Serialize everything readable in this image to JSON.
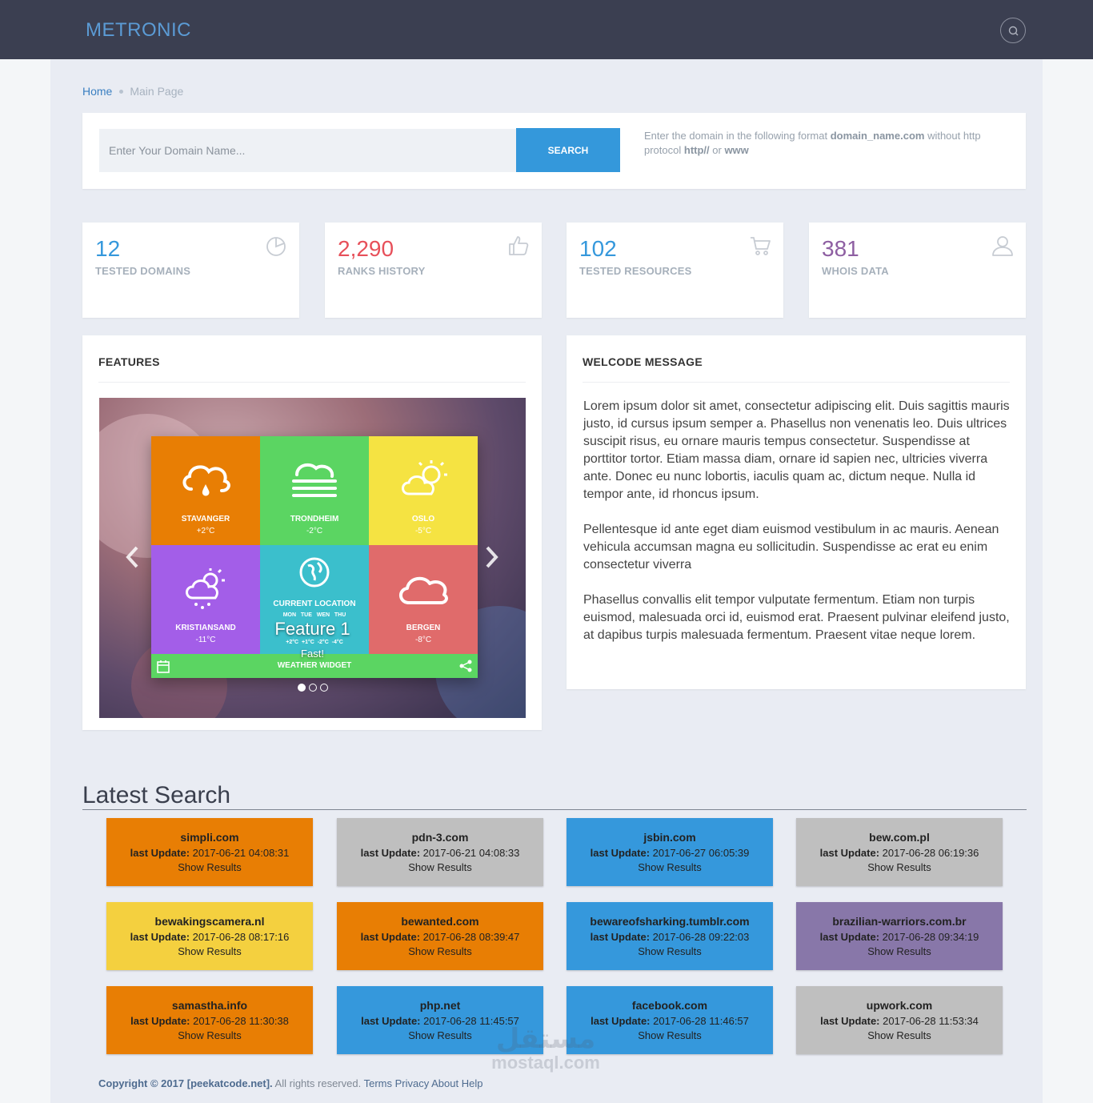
{
  "header": {
    "logo": "METRONIC",
    "search_icon": "search-icon"
  },
  "breadcrumb": {
    "home": "Home",
    "current": "Main Page"
  },
  "search_panel": {
    "placeholder": "Enter Your Domain Name...",
    "button": "SEARCH",
    "help_1": "Enter the domain in the following format ",
    "help_bold_1": "domain_name.com",
    "help_2": " without http protocol ",
    "help_bold_2": "http//",
    "help_3": " or ",
    "help_bold_3": "www"
  },
  "stats": [
    {
      "value": "12",
      "label": "TESTED DOMAINS",
      "color": "#3598dc",
      "icon": "pie-chart-icon"
    },
    {
      "value": "2,290",
      "label": "RANKS HISTORY",
      "color": "#e7505a",
      "icon": "thumbs-up-icon"
    },
    {
      "value": "102",
      "label": "TESTED RESOURCES",
      "color": "#3598dc",
      "icon": "shopping-cart-icon"
    },
    {
      "value": "381",
      "label": "WHOIS DATA",
      "color": "#8e5fa2",
      "icon": "user-icon"
    }
  ],
  "features": {
    "title": "FEATURES",
    "caption": "Feature 1",
    "sub": "Fast!",
    "widget_bar": "WEATHER WIDGET",
    "tiles": [
      {
        "name": "STAVANGER",
        "temp": "+2°C",
        "color": "#e87e04",
        "icon": "rain-cloud-icon"
      },
      {
        "name": "TRONDHEIM",
        "temp": "-2°C",
        "color": "#5bd562",
        "icon": "fog-cloud-icon"
      },
      {
        "name": "OSLO",
        "temp": "-5°C",
        "color": "#f5e342",
        "icon": "sun-cloud-icon"
      },
      {
        "name": "KRISTIANSAND",
        "temp": "-11°C",
        "color": "#a35ee8",
        "icon": "snow-sun-icon"
      },
      {
        "name": "CURRENT LOCATION",
        "temp": "",
        "color": "#3bbfcc",
        "icon": "globe-icon",
        "days": "MON   TUE   WEN   THU",
        "temps": "+2°C  +1°C  -2°C  -4°C"
      },
      {
        "name": "BERGEN",
        "temp": "-8°C",
        "color": "#e06b6b",
        "icon": "cloud-icon"
      }
    ],
    "dots_active": 1
  },
  "welcome": {
    "title": "WELCODE MESSAGE",
    "p1": "Lorem ipsum dolor sit amet, consectetur adipiscing elit. Duis sagittis mauris justo, id cursus ipsum semper a. Phasellus non venenatis leo. Duis ultrices suscipit risus, eu ornare mauris tempus consectetur. Suspendisse at porttitor tortor. Etiam massa diam, ornare id sapien nec, ultricies viverra ante. Donec eu nunc lobortis, iaculis quam ac, dictum neque. Nulla id tempor ante, id rhoncus ipsum.",
    "p2": "Pellentesque id ante eget diam euismod vestibulum in ac mauris. Aenean vehicula accumsan magna eu sollicitudin. Suspendisse ac erat eu enim consectetur viverra",
    "p3": "Phasellus convallis elit tempor vulputate fermentum. Etiam non turpis euismod, malesuada orci id, euismod erat. Praesent pulvinar eleifend justo, at dapibus turpis malesuada fermentum. Praesent vitae neque lorem."
  },
  "latest": {
    "title": "Latest Search",
    "update_label": "last Update:",
    "show_label": "Show Results",
    "items": [
      {
        "domain": "simpli.com",
        "date": "2017-06-21 04:08:31",
        "color": "#e87e04"
      },
      {
        "domain": "pdn-3.com",
        "date": "2017-06-21 04:08:33",
        "color": "#bfbfbf"
      },
      {
        "domain": "jsbin.com",
        "date": "2017-06-27 06:05:39",
        "color": "#3598dc"
      },
      {
        "domain": "bew.com.pl",
        "date": "2017-06-28 06:19:36",
        "color": "#bfbfbf"
      },
      {
        "domain": "bewakingscamera.nl",
        "date": "2017-06-28 08:17:16",
        "color": "#f4d03f"
      },
      {
        "domain": "bewanted.com",
        "date": "2017-06-28 08:39:47",
        "color": "#e87e04"
      },
      {
        "domain": "bewareofsharking.tumblr.com",
        "date": "2017-06-28 09:22:03",
        "color": "#3598dc"
      },
      {
        "domain": "brazilian-warriors.com.br",
        "date": "2017-06-28 09:34:19",
        "color": "#8877a9"
      },
      {
        "domain": "samastha.info",
        "date": "2017-06-28 11:30:38",
        "color": "#e87e04"
      },
      {
        "domain": "php.net",
        "date": "2017-06-28 11:45:57",
        "color": "#3598dc"
      },
      {
        "domain": "facebook.com",
        "date": "2017-06-28 11:46:57",
        "color": "#3598dc"
      },
      {
        "domain": "upwork.com",
        "date": "2017-06-28 11:53:34",
        "color": "#bfbfbf"
      }
    ]
  },
  "footer": {
    "copyright": "Copyright © 2017",
    "brand": "[peekatcode.net].",
    "rights": " All rights reserved.",
    "links": [
      "Terms",
      "Privacy",
      "About",
      "Help"
    ]
  },
  "watermark": {
    "arabic": "مستقل",
    "latin": "mostaql.com"
  }
}
